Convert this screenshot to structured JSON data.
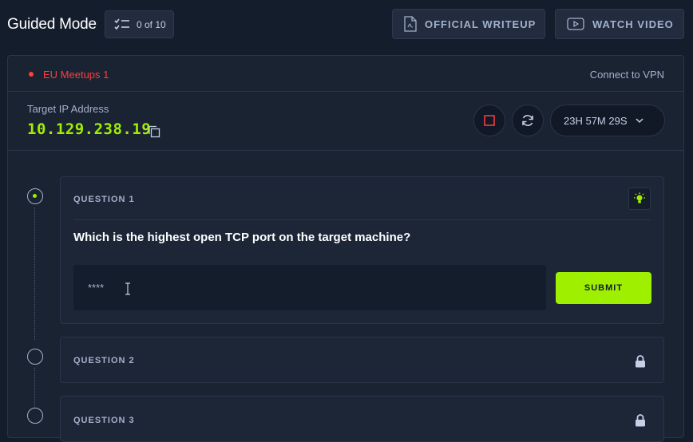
{
  "header": {
    "mode_title": "Guided Mode",
    "progress": "0 of 10",
    "writeup_label": "OFFICIAL WRITEUP",
    "video_label": "WATCH VIDEO",
    "icons": {
      "progress": "checklist-icon",
      "writeup": "pdf-document-icon",
      "video": "play-video-icon"
    }
  },
  "machine": {
    "name": "EU Meetups 1",
    "status_color": "#ff3e3e",
    "vpn_label": "Connect to VPN"
  },
  "target": {
    "ip_label": "Target IP Address",
    "ip": "10.129.238.19",
    "timer": "23H 57M 29S",
    "icons": {
      "copy": "copy-icon",
      "stop": "stop-icon",
      "reset": "refresh-icon",
      "timer_expand": "chevron-down-icon"
    }
  },
  "questions": [
    {
      "label": "QUESTION 1",
      "text": "Which is the highest open TCP port on the target machine?",
      "answer_placeholder": "****",
      "submit_label": "SUBMIT",
      "status": "active",
      "icon": "lightbulb-hint-icon"
    },
    {
      "label": "QUESTION 2",
      "status": "locked",
      "icon": "lock-icon"
    },
    {
      "label": "QUESTION 3",
      "status": "locked",
      "icon": "lock-icon"
    }
  ],
  "colors": {
    "accent": "#9fef00",
    "danger": "#ff3e3e",
    "background": "#141d2b",
    "panel": "#1a2332",
    "text": "#a4b1cd"
  }
}
